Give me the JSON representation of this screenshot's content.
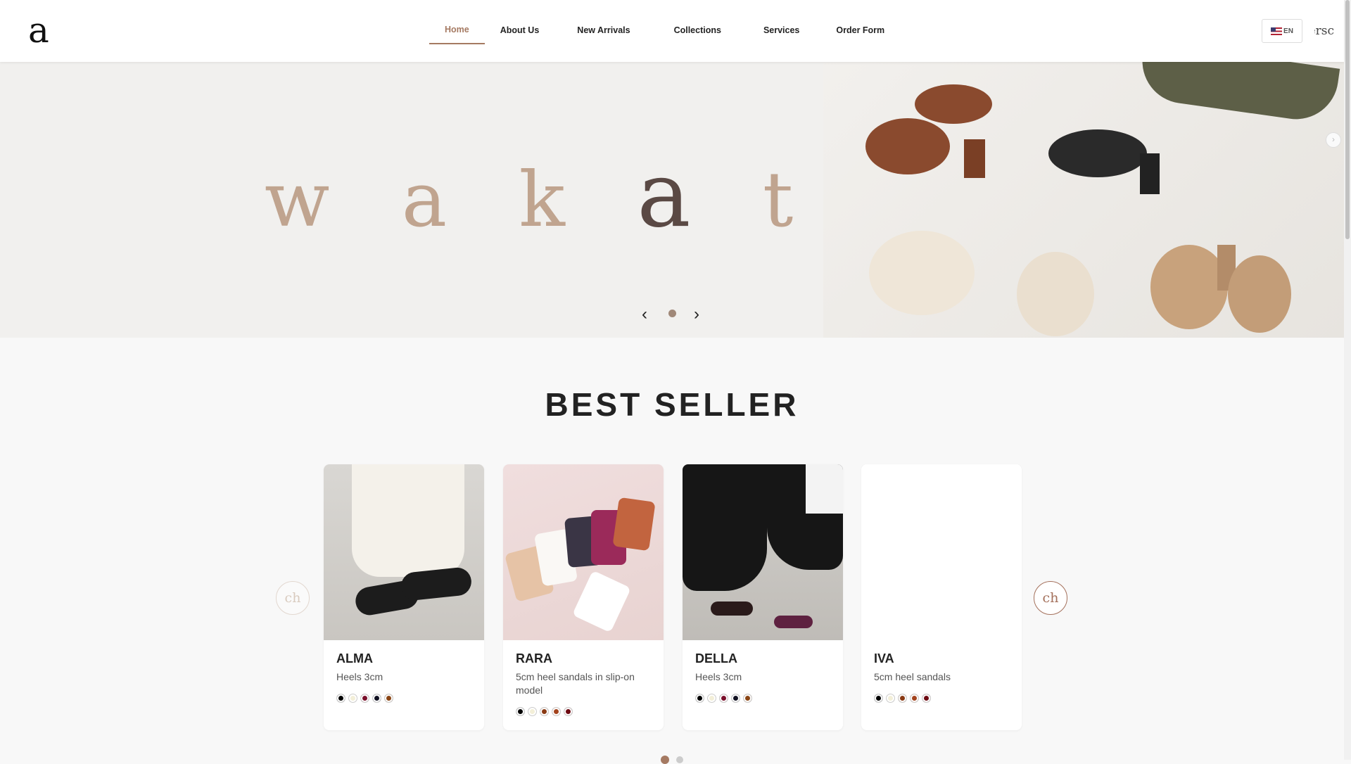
{
  "header": {
    "logo_text": "a",
    "nav": [
      "Home",
      "About Us",
      "New Arrivals",
      "Collections",
      "Services",
      "Order Form"
    ],
    "active": "Home",
    "lang_label": "EN",
    "clipped_text": "ersc"
  },
  "hero": {
    "brand_parts": [
      "w a k ",
      "a",
      " t a"
    ],
    "prev_icon": "‹",
    "next_icon": "›",
    "side_arrow": "›"
  },
  "best_seller": {
    "title": "BEST SELLER",
    "prev_label": "ch",
    "next_label": "ch",
    "products": [
      {
        "name": "ALMA",
        "desc": "Heels 3cm",
        "colors": [
          "#000000",
          "#f3efd8",
          "#7a0f2b",
          "#111122",
          "#8a4514"
        ]
      },
      {
        "name": "RARA",
        "desc": "5cm heel sandals in slip-on model",
        "colors": [
          "#000000",
          "#f3efd8",
          "#8a3a14",
          "#a3441e",
          "#6e0a12"
        ]
      },
      {
        "name": "DELLA",
        "desc": "Heels 3cm",
        "colors": [
          "#000000",
          "#f3efd8",
          "#7a0f2b",
          "#111122",
          "#8a4514"
        ]
      },
      {
        "name": "IVA",
        "desc": "5cm heel sandals",
        "colors": [
          "#000000",
          "#f3efd8",
          "#8a3a14",
          "#a3441e",
          "#6e0a12"
        ]
      }
    ]
  },
  "colors": {
    "accent": "#a57a62",
    "hero_text": "#c0a48f",
    "hero_text_dark": "#5a4944"
  }
}
